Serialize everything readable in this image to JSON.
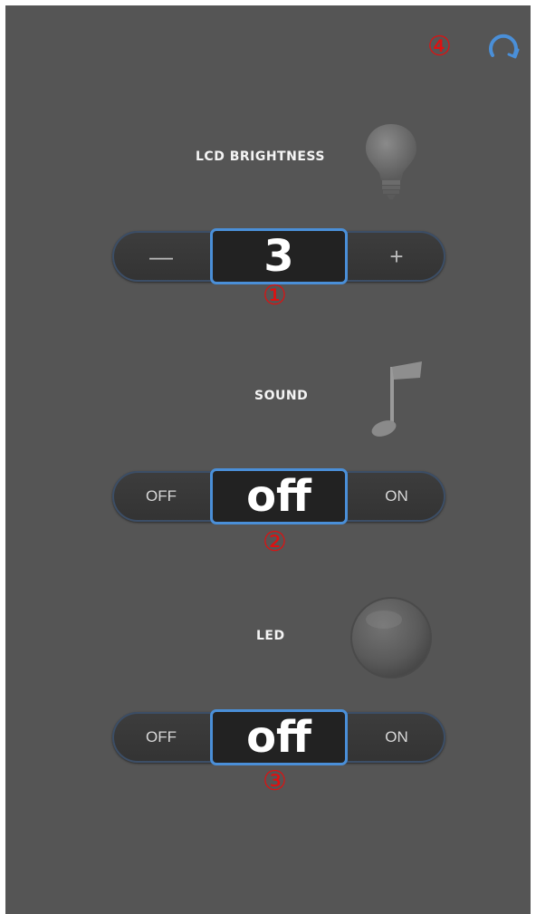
{
  "annotations": {
    "one": "①",
    "two": "②",
    "three": "③",
    "four": "④"
  },
  "header": {
    "refresh_icon": "refresh-icon"
  },
  "brightness": {
    "label": "LCD BRIGHTNESS",
    "icon": "lightbulb-icon",
    "decrease_label": "—",
    "increase_label": "+",
    "value": "3"
  },
  "sound": {
    "label": "SOUND",
    "icon": "music-note-icon",
    "off_label": "OFF",
    "on_label": "ON",
    "value": "off"
  },
  "led": {
    "label": "LED",
    "icon": "led-orb-icon",
    "off_label": "OFF",
    "on_label": "ON",
    "value": "off"
  },
  "colors": {
    "background": "#555555",
    "accent": "#4a8fd8",
    "annotation": "#e01010"
  }
}
